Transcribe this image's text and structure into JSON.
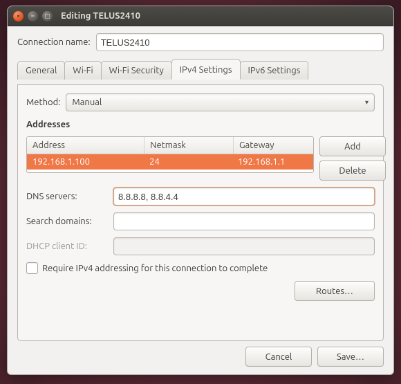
{
  "window": {
    "title": "Editing TELUS2410"
  },
  "conn": {
    "name_label": "Connection name:",
    "name_value": "TELUS2410"
  },
  "tabs": {
    "general": "General",
    "wifi": "Wi-Fi",
    "wifisec": "Wi-Fi Security",
    "ipv4": "IPv4 Settings",
    "ipv6": "IPv6 Settings"
  },
  "ipv4": {
    "method_label": "Method:",
    "method_value": "Manual",
    "addresses_title": "Addresses",
    "columns": {
      "address": "Address",
      "netmask": "Netmask",
      "gateway": "Gateway"
    },
    "rows": [
      {
        "address": "192.168.1.100",
        "netmask": "24",
        "gateway": "192.168.1.1"
      }
    ],
    "add": "Add",
    "delete": "Delete",
    "dns_label": "DNS servers:",
    "dns_value": "8.8.8.8, 8.8.4.4",
    "search_label": "Search domains:",
    "search_value": "",
    "dhcp_label": "DHCP client ID:",
    "dhcp_value": "",
    "require_label": "Require IPv4 addressing for this connection to complete",
    "routes": "Routes…"
  },
  "footer": {
    "cancel": "Cancel",
    "save": "Save…"
  }
}
